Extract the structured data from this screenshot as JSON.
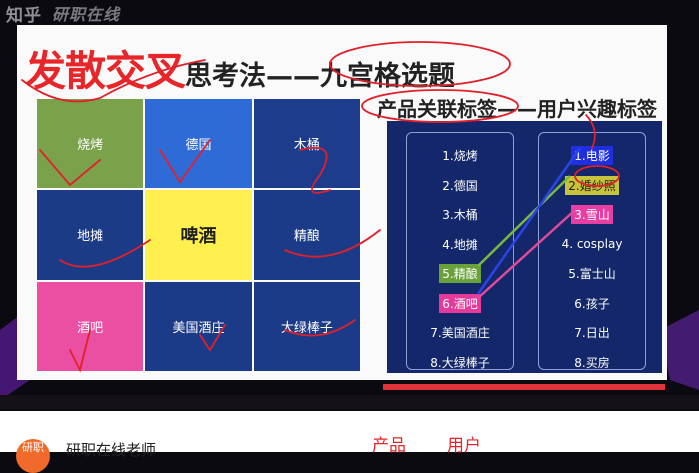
{
  "watermark": {
    "brand": "知乎",
    "channel": "研职在线"
  },
  "slide": {
    "title_main": "发散交叉",
    "title_sub": "思考法——九宫格选题",
    "subtitle": "产品关联标签——用户兴趣标签",
    "grid": [
      {
        "label": "烧烤",
        "color": "#7aa24a"
      },
      {
        "label": "德国",
        "color": "#2f6bd6"
      },
      {
        "label": "木桶",
        "color": "#1d3d8c"
      },
      {
        "label": "地摊",
        "color": "#1c3b86"
      },
      {
        "label": "啤酒",
        "color": "#fff04f"
      },
      {
        "label": "精酿",
        "color": "#1b3a88"
      },
      {
        "label": "酒吧",
        "color": "#ea4fa2"
      },
      {
        "label": "美国酒庄",
        "color": "#1b3a88"
      },
      {
        "label": "大绿棒子",
        "color": "#1b3a88"
      }
    ],
    "product_tags": [
      "1.烧烤",
      "2.德国",
      "3.木桶",
      "4.地摊",
      "5.精酿",
      "6.酒吧",
      "7.美国酒庄",
      "8.大绿棒子"
    ],
    "user_tags": [
      "1.电影",
      "2.婚纱照",
      "3.雪山",
      "4. cosplay",
      "5.富士山",
      "6.孩子",
      "7.日出",
      "8.买房"
    ]
  },
  "caption": {
    "left": "产品",
    "right": "用户"
  },
  "author": {
    "name": "研职在线老师",
    "avatar_text": "研职"
  }
}
